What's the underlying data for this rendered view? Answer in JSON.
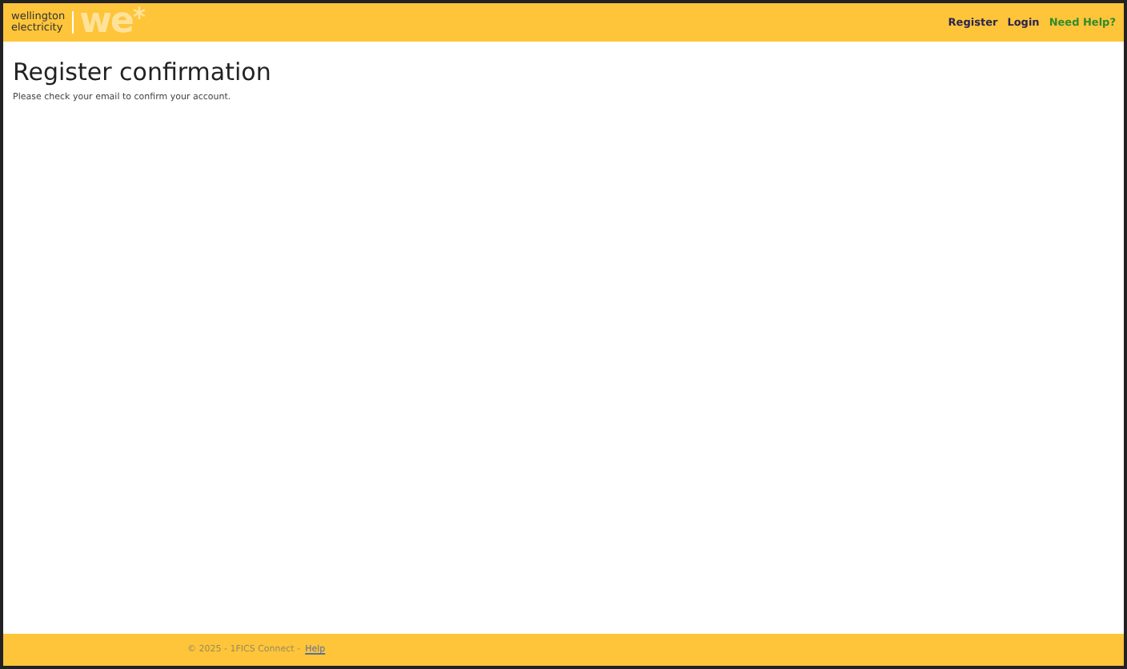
{
  "header": {
    "logo": {
      "line_1": "wellington",
      "line_2": "electricity",
      "mark": "we"
    },
    "nav": [
      {
        "label": "Register",
        "kind": "link"
      },
      {
        "label": "Login",
        "kind": "link"
      },
      {
        "label": "Need Help?",
        "kind": "help"
      }
    ]
  },
  "main": {
    "title": "Register confirmation",
    "message": "Please check your email to confirm your account."
  },
  "footer": {
    "text": "© 2025 - 1FICS Connect -",
    "link": "Help"
  }
}
